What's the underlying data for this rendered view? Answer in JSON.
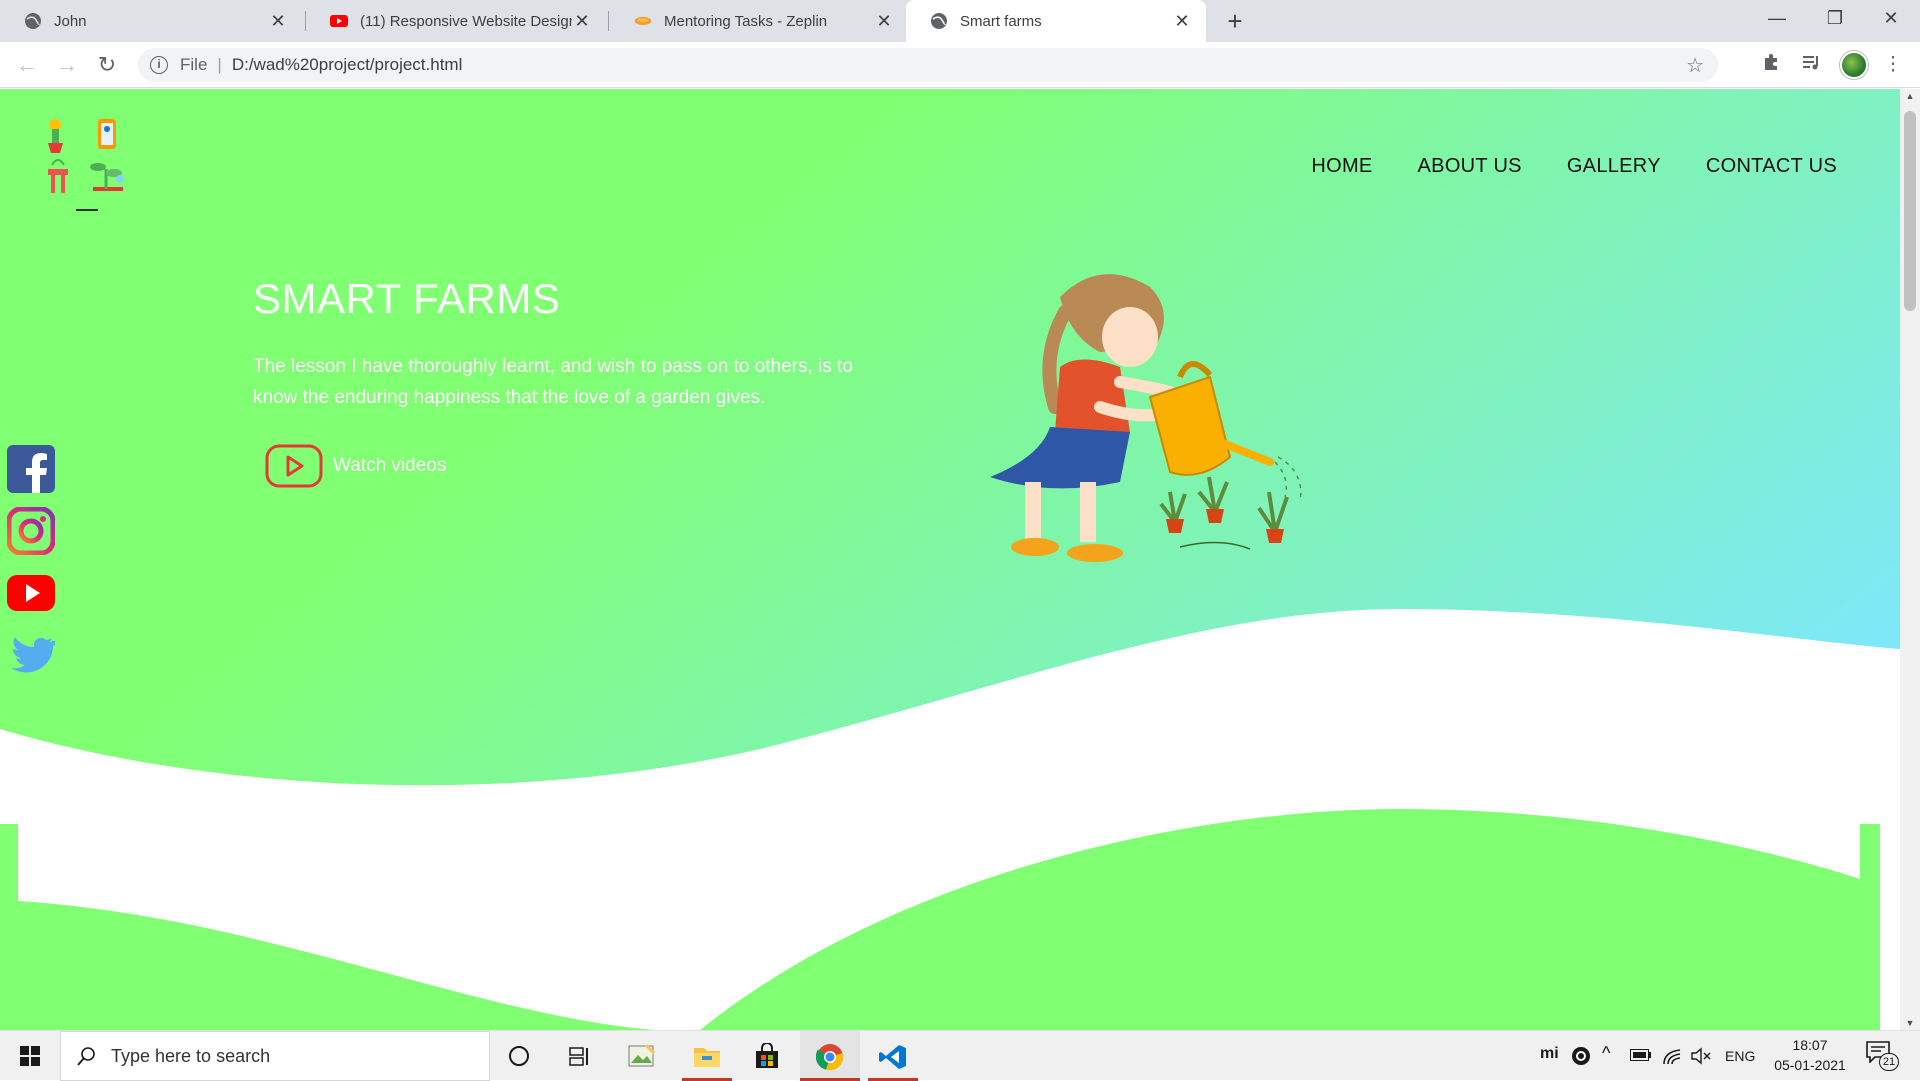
{
  "browser": {
    "tabs": [
      {
        "title": "John",
        "icon": "globe-icon"
      },
      {
        "title": "(11) Responsive Website Design -",
        "icon": "youtube-icon"
      },
      {
        "title": "Mentoring Tasks - Zeplin",
        "icon": "zeplin-icon"
      },
      {
        "title": "Smart farms",
        "icon": "globe-icon",
        "active": true
      }
    ],
    "address": {
      "scheme_label": "File",
      "url": "D:/wad%20project/project.html"
    }
  },
  "site": {
    "nav": [
      "HOME",
      "ABOUT US",
      "GALLERY",
      "CONTACT US"
    ],
    "hero": {
      "title": "SMART FARMS",
      "text": "The lesson I have thoroughly learnt, and wish to pass on to others, is to know the enduring happiness that the love of a garden gives.",
      "cta": "Watch videos"
    },
    "social": [
      "facebook-icon",
      "instagram-icon",
      "youtube-icon",
      "twitter-icon"
    ],
    "colors": {
      "green": "#80ff72",
      "aqua": "#7ee8fa",
      "youtube_red": "#ff0000",
      "facebook_blue": "#3b5998",
      "twitter_blue": "#55acee"
    }
  },
  "taskbar": {
    "search_placeholder": "Type here to search",
    "lang": "ENG",
    "time": "18:07",
    "date": "05-01-2021",
    "notification_count": "21"
  }
}
